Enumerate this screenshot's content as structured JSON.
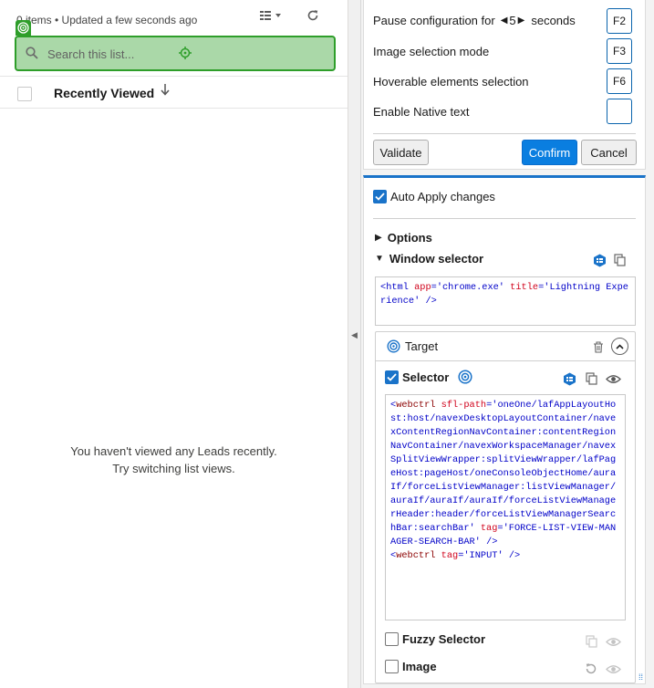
{
  "list": {
    "meta": "0 items • Updated a few seconds ago",
    "search_placeholder": "Search this list...",
    "column_title": "Recently Viewed",
    "empty_line1": "You haven't viewed any Leads recently.",
    "empty_line2": "Try switching list views."
  },
  "config": {
    "pause_label": "Pause configuration for",
    "pause_value": "5",
    "pause_unit": "seconds",
    "pause_key": "F2",
    "image_mode_label": "Image selection mode",
    "image_mode_key": "F3",
    "hover_label": "Hoverable elements selection",
    "hover_key": "F6",
    "native_text_label": "Enable Native text",
    "native_text_key": "",
    "validate_label": "Validate",
    "confirm_label": "Confirm",
    "cancel_label": "Cancel"
  },
  "panel": {
    "auto_apply_label": "Auto Apply changes",
    "auto_apply_checked": true,
    "options_label": "Options",
    "window_selector_label": "Window selector",
    "target_label": "Target",
    "selector_label": "Selector",
    "selector_checked": true,
    "fuzzy_label": "Fuzzy Selector",
    "fuzzy_checked": false,
    "image_label": "Image",
    "image_checked": false
  },
  "window_selector_code": {
    "tag": "html",
    "attrs": [
      {
        "name": "app",
        "value": "'chrome.exe'"
      },
      {
        "name": "title",
        "value": "'Lightning Experience'"
      }
    ]
  },
  "selector_code": {
    "line1_tag": "webctrl",
    "line1_attr": "sfl-path",
    "line1_value": "'oneOne/lafAppLayoutHost:host/navexDesktopLayoutContainer/navexContentRegionNavContainer:contentRegionNavContainer/navexWorkspaceManager/navexSplitViewWrapper:splitViewWrapper/lafPageHost:pageHost/oneConsoleObjectHome/auraIf/forceListViewManager:listViewManager/auraIf/auraIf/auraIf/forceListViewManagerHeader:header/forceListViewManagerSearchBar:searchBar'",
    "line1_attr2": "tag",
    "line1_value2": "'FORCE-LIST-VIEW-MANAGER-SEARCH-BAR'",
    "line2_tag": "webctrl",
    "line2_attr": "tag",
    "line2_value": "'INPUT'"
  },
  "colors": {
    "highlight_fill": "#aad8a8",
    "highlight_border": "#2e9e2a",
    "accent_blue": "#1a73c9",
    "confirm_blue": "#0a7ee0"
  }
}
